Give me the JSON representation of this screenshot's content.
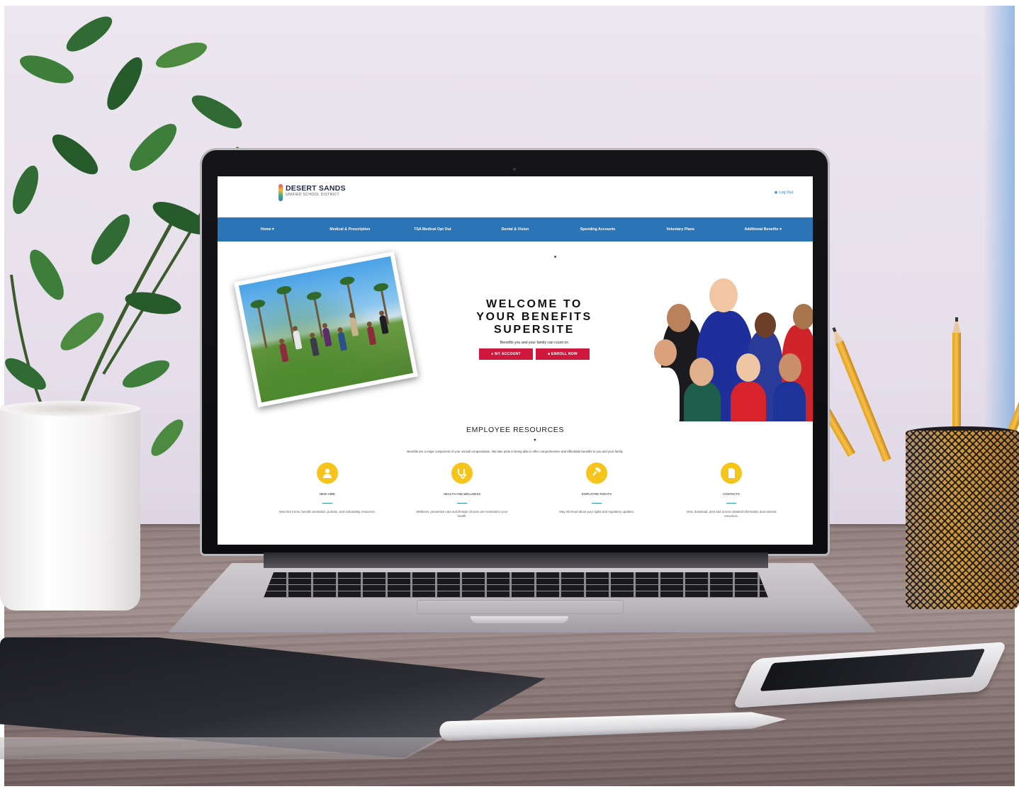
{
  "site": {
    "logo": {
      "name": "DESERT SANDS",
      "subtitle": "UNIFIED SCHOOL DISTRICT"
    },
    "login_link": "Log Out",
    "nav": [
      {
        "label": "Home",
        "has_dropdown": true
      },
      {
        "label": "Medical & Prescription"
      },
      {
        "label": "TSA Medical Opt Out"
      },
      {
        "label": "Dental & Vision"
      },
      {
        "label": "Spending Accounts"
      },
      {
        "label": "Voluntary Plans"
      },
      {
        "label": "Additional Benefits",
        "has_dropdown": true
      }
    ],
    "hero": {
      "title_lines": [
        "WELCOME TO",
        "YOUR BENEFITS",
        "SUPERSITE"
      ],
      "subtitle": "Benefits you and your family can count on",
      "buttons": [
        {
          "label": "MY ACCOUNT",
          "icon": "user-icon"
        },
        {
          "label": "ENROLL NOW",
          "icon": "document-icon"
        }
      ]
    },
    "resources": {
      "title": "EMPLOYEE RESOURCES",
      "description": "Benefits are a major component of your overall compensation. We take pride in being able to offer comprehensive and affordable benefits to you and your family.",
      "cards": [
        {
          "title": "NEW HIRE",
          "icon": "user-icon",
          "description": "New hire forms, benefit orientation, policies, and onboarding resources."
        },
        {
          "title": "HEALTH AND WELLNESS",
          "icon": "stethoscope-icon",
          "description": "Wellness, preventive care and lifestyle choices are essential to your health."
        },
        {
          "title": "EMPLOYEE RIGHTS",
          "icon": "gavel-icon",
          "description": "Stay informed about your rights and regulatory updates."
        },
        {
          "title": "CONTACTS",
          "icon": "document-icon",
          "description": "View, download, print and access detailed information and external resources."
        }
      ]
    },
    "colors": {
      "nav_blue": "#2b74b5",
      "button_red": "#d0183c",
      "icon_yellow": "#f6c51b",
      "rule_teal": "#2a9ab0"
    }
  }
}
